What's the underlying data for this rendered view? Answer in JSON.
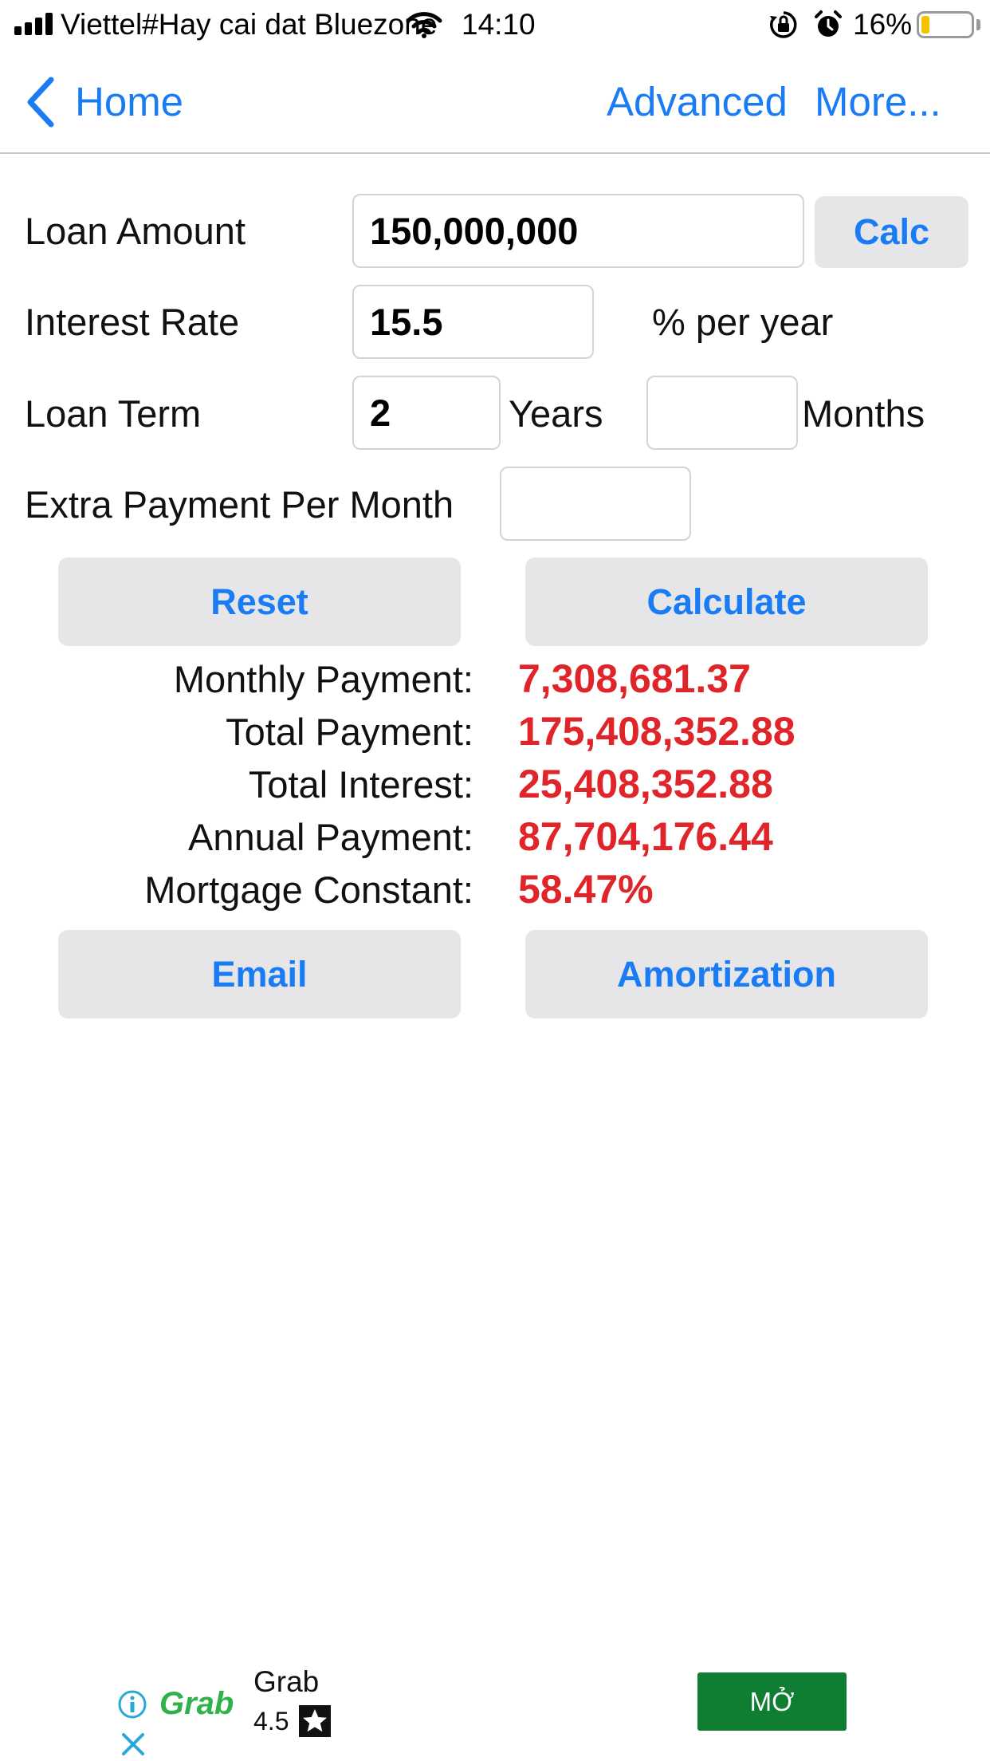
{
  "status_bar": {
    "carrier": "Viettel#Hay cai dat Bluezone",
    "time": "14:10",
    "battery_percent": "16%",
    "battery_level": 0.16
  },
  "nav": {
    "back_label": "Home",
    "advanced_label": "Advanced",
    "more_label": "More..."
  },
  "form": {
    "loan_amount_label": "Loan Amount",
    "loan_amount_value": "150,000,000",
    "calc_label": "Calc",
    "interest_rate_label": "Interest Rate",
    "interest_rate_value": "15.5",
    "interest_unit": "% per year",
    "loan_term_label": "Loan Term",
    "loan_term_years_value": "2",
    "years_label": "Years",
    "loan_term_months_value": "",
    "months_label": "Months",
    "extra_payment_label": "Extra Payment Per Month",
    "extra_payment_value": ""
  },
  "buttons": {
    "reset": "Reset",
    "calculate": "Calculate",
    "email": "Email",
    "amortization": "Amortization"
  },
  "results": {
    "monthly_payment_label": "Monthly Payment:",
    "monthly_payment_value": "7,308,681.37",
    "total_payment_label": "Total Payment:",
    "total_payment_value": "175,408,352.88",
    "total_interest_label": "Total Interest:",
    "total_interest_value": "25,408,352.88",
    "annual_payment_label": "Annual Payment:",
    "annual_payment_value": "87,704,176.44",
    "mortgage_constant_label": "Mortgage Constant:",
    "mortgage_constant_value": "58.47%"
  },
  "ad": {
    "logo_text": "Grab",
    "app_name": "Grab",
    "rating": "4.5",
    "open_label": "MỞ"
  },
  "colors": {
    "accent": "#1a7cf5",
    "result_red": "#e0252a",
    "button_bg": "#e6e6e8",
    "ad_button": "#0f7d32",
    "grab_green": "#2fb24a",
    "battery_yellow": "#f5c400"
  }
}
